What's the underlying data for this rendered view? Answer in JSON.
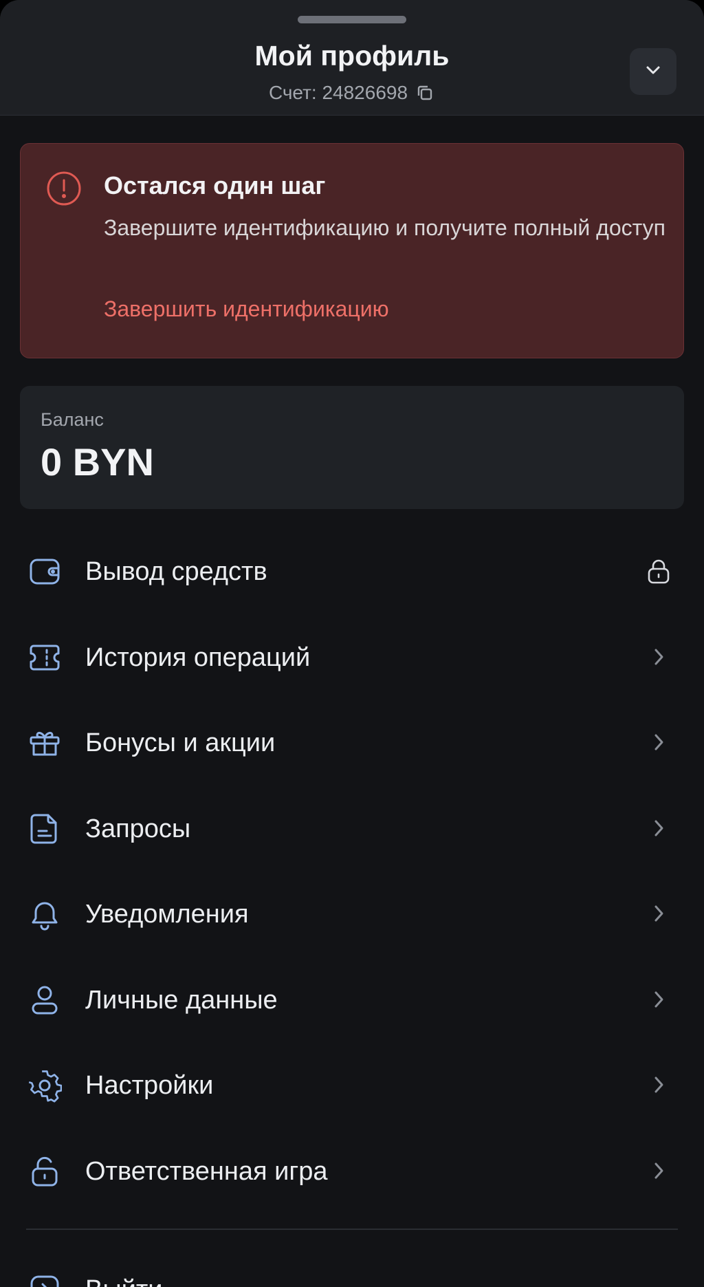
{
  "header": {
    "title": "Мой профиль",
    "account_label": "Счет: 24826698",
    "collapse_icon": "chevron-down-icon",
    "copy_icon": "copy-icon"
  },
  "alert": {
    "icon": "exclamation-circle-icon",
    "title": "Остался один шаг",
    "text": "Завершите идентификацию и получите полный доступ",
    "link": "Завершить идентификацию",
    "accent_color": "#ee7068",
    "background_color": "#4a2426"
  },
  "balance": {
    "label": "Баланс",
    "value": "0 BYN"
  },
  "menu": {
    "items": [
      {
        "label": "Вывод средств",
        "icon": "wallet-icon",
        "trailing": "lock-icon"
      },
      {
        "label": "История операций",
        "icon": "ticket-icon",
        "trailing": "chevron-right-icon"
      },
      {
        "label": "Бонусы и акции",
        "icon": "gift-icon",
        "trailing": "chevron-right-icon"
      },
      {
        "label": "Запросы",
        "icon": "document-icon",
        "trailing": "chevron-right-icon"
      },
      {
        "label": "Уведомления",
        "icon": "bell-icon",
        "trailing": "chevron-right-icon"
      },
      {
        "label": "Личные данные",
        "icon": "user-icon",
        "trailing": "chevron-right-icon"
      },
      {
        "label": "Настройки",
        "icon": "gear-icon",
        "trailing": "chevron-right-icon"
      },
      {
        "label": "Ответственная игра",
        "icon": "unlock-icon",
        "trailing": "chevron-right-icon"
      }
    ],
    "logout_label": "Выйти",
    "logout_icon": "logout-icon",
    "icon_color": "#8fb3e8"
  }
}
